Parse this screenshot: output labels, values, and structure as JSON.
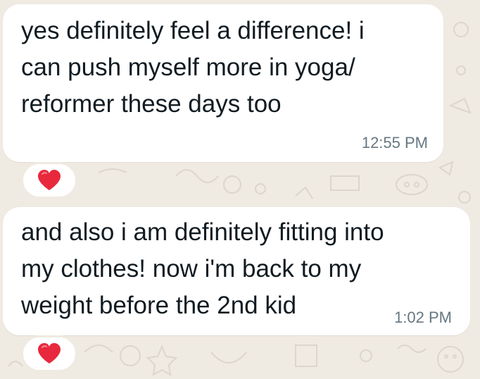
{
  "colors": {
    "wallpaper": "#efeae2",
    "bubble": "#ffffff",
    "text": "#111b21",
    "timestamp": "#667781",
    "heart": "#e8283c"
  },
  "messages": [
    {
      "lines": [
        "yes definitely feel a difference! i",
        "can push myself more in yoga/",
        "reformer these days too"
      ],
      "time": "12:55 PM",
      "reaction": "red-heart-icon"
    },
    {
      "lines": [
        "and also i am definitely fitting into",
        "my clothes! now i'm back to my",
        "weight before the 2nd kid"
      ],
      "time": "1:02 PM",
      "reaction": "red-heart-icon"
    }
  ]
}
